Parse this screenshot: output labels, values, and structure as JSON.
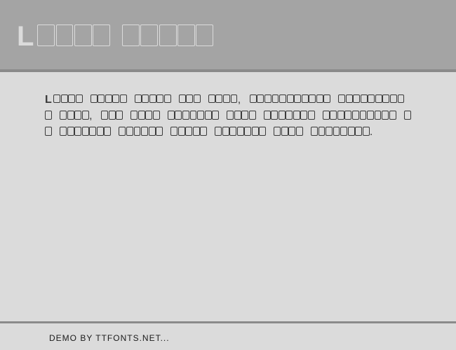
{
  "header": {
    "title_first": "L",
    "title_rest_words": [
      4,
      5
    ]
  },
  "body": {
    "first": "L",
    "segments": [
      {
        "boxes": 4,
        "after": " "
      },
      {
        "boxes": 5,
        "after": " "
      },
      {
        "boxes": 5,
        "after": " "
      },
      {
        "boxes": 3,
        "after": " "
      },
      {
        "boxes": 4,
        "after": ", "
      },
      {
        "boxes": 11,
        "after": " "
      },
      {
        "boxes": 10,
        "after": " "
      },
      {
        "boxes": 4,
        "after": ", "
      },
      {
        "boxes": 3,
        "after": " "
      },
      {
        "boxes": 4,
        "after": " "
      },
      {
        "boxes": 7,
        "after": " "
      },
      {
        "boxes": 4,
        "after": " "
      },
      {
        "boxes": 7,
        "after": " "
      },
      {
        "boxes": 10,
        "after": " "
      },
      {
        "boxes": 2,
        "after": " "
      },
      {
        "boxes": 7,
        "after": " "
      },
      {
        "boxes": 6,
        "after": " "
      },
      {
        "boxes": 5,
        "after": " "
      },
      {
        "boxes": 7,
        "after": " "
      },
      {
        "boxes": 4,
        "after": " "
      },
      {
        "boxes": 8,
        "after": "."
      }
    ]
  },
  "footer": {
    "text": "Demo by ttfonts.net..."
  }
}
